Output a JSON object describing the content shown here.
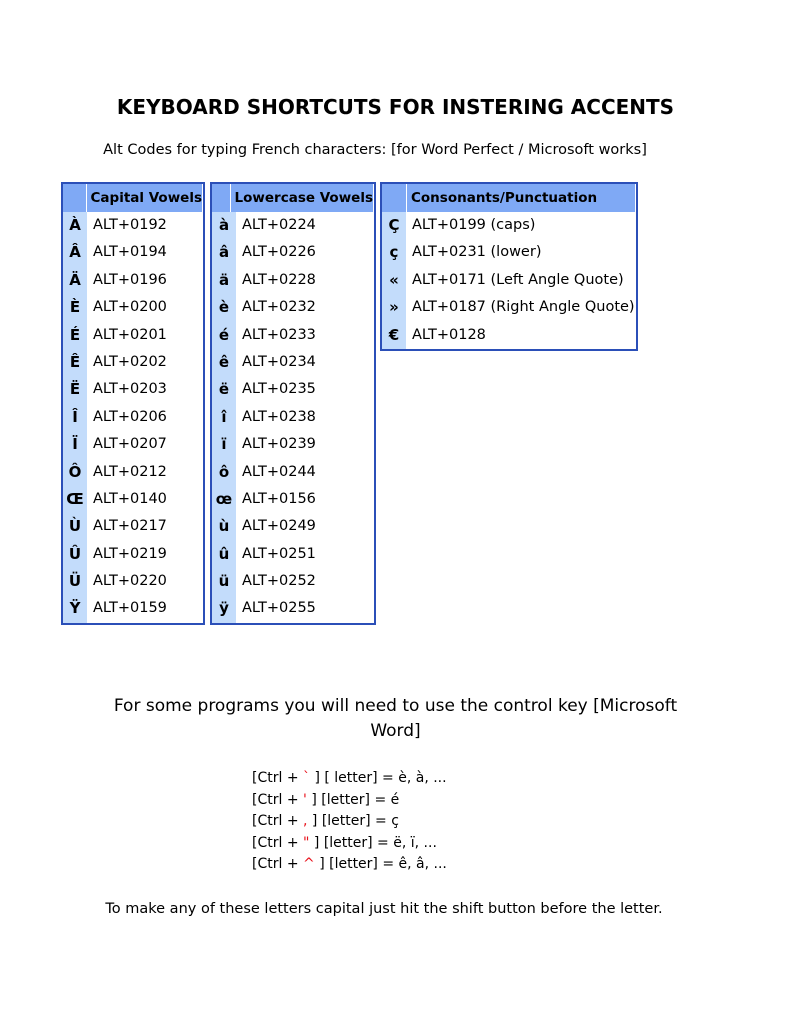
{
  "title": "KEYBOARD SHORTCUTS FOR INSTERING ACCENTS",
  "subtitle": "Alt Codes for typing French characters: [for Word Perfect / Microsoft works]",
  "colors": {
    "table_border": "#2b4fb8",
    "header_fill": "#7fa9f5",
    "key_column_fill": "#c3dcfb",
    "shortcut_symbol": "#e8101a"
  },
  "tables": {
    "capital": {
      "header": "Capital Vowels",
      "rows": [
        {
          "char": "À",
          "code": "ALT+0192"
        },
        {
          "char": "Â",
          "code": "ALT+0194"
        },
        {
          "char": "Ä",
          "code": "ALT+0196"
        },
        {
          "char": "È",
          "code": "ALT+0200"
        },
        {
          "char": "É",
          "code": "ALT+0201"
        },
        {
          "char": "Ê",
          "code": "ALT+0202"
        },
        {
          "char": "Ë",
          "code": "ALT+0203"
        },
        {
          "char": "Î",
          "code": "ALT+0206"
        },
        {
          "char": "Ï",
          "code": "ALT+0207"
        },
        {
          "char": "Ô",
          "code": "ALT+0212"
        },
        {
          "char": "Œ",
          "code": "ALT+0140"
        },
        {
          "char": "Ù",
          "code": "ALT+0217"
        },
        {
          "char": "Û",
          "code": "ALT+0219"
        },
        {
          "char": "Ü",
          "code": "ALT+0220"
        },
        {
          "char": "Ÿ",
          "code": "ALT+0159"
        }
      ]
    },
    "lowercase": {
      "header": "Lowercase Vowels",
      "rows": [
        {
          "char": "à",
          "code": "ALT+0224"
        },
        {
          "char": "â",
          "code": "ALT+0226"
        },
        {
          "char": "ä",
          "code": "ALT+0228"
        },
        {
          "char": "è",
          "code": "ALT+0232"
        },
        {
          "char": "é",
          "code": "ALT+0233"
        },
        {
          "char": "ê",
          "code": "ALT+0234"
        },
        {
          "char": "ë",
          "code": "ALT+0235"
        },
        {
          "char": "î",
          "code": "ALT+0238"
        },
        {
          "char": "ï",
          "code": "ALT+0239"
        },
        {
          "char": "ô",
          "code": "ALT+0244"
        },
        {
          "char": "œ",
          "code": "ALT+0156"
        },
        {
          "char": "ù",
          "code": "ALT+0249"
        },
        {
          "char": "û",
          "code": "ALT+0251"
        },
        {
          "char": "ü",
          "code": "ALT+0252"
        },
        {
          "char": "ÿ",
          "code": "ALT+0255"
        }
      ]
    },
    "consonants": {
      "header": "Consonants/Punctuation",
      "rows": [
        {
          "char": "Ç",
          "code": "ALT+0199 (caps)"
        },
        {
          "char": "ç",
          "code": "ALT+0231 (lower)"
        },
        {
          "char": "«",
          "code": "ALT+0171 (Left Angle Quote)"
        },
        {
          "char": "»",
          "code": "ALT+0187 (Right Angle Quote)"
        },
        {
          "char": "€",
          "code": "ALT+0128"
        }
      ]
    }
  },
  "control_section": {
    "intro_line1": "For some programs you will need to use the control key [Microsoft",
    "intro_line2": "Word]",
    "shortcuts": [
      {
        "prefix": "[Ctrl + ",
        "symbol": "`",
        "suffix": " ] [ letter] = è, à, ..."
      },
      {
        "prefix": "[Ctrl + ",
        "symbol": "'",
        "suffix": " ] [letter] = é"
      },
      {
        "prefix": "[Ctrl + ",
        "symbol": ",",
        "suffix": " ] [letter] = ç"
      },
      {
        "prefix": "[Ctrl + ",
        "symbol": "\"",
        "suffix": " ] [letter] = ë, ï, ..."
      },
      {
        "prefix": "[Ctrl + ",
        "symbol": "^",
        "suffix": " ] [letter] = ê, â, ..."
      }
    ]
  },
  "footer_note": "To make any of these letters capital just hit the shift button before the letter."
}
